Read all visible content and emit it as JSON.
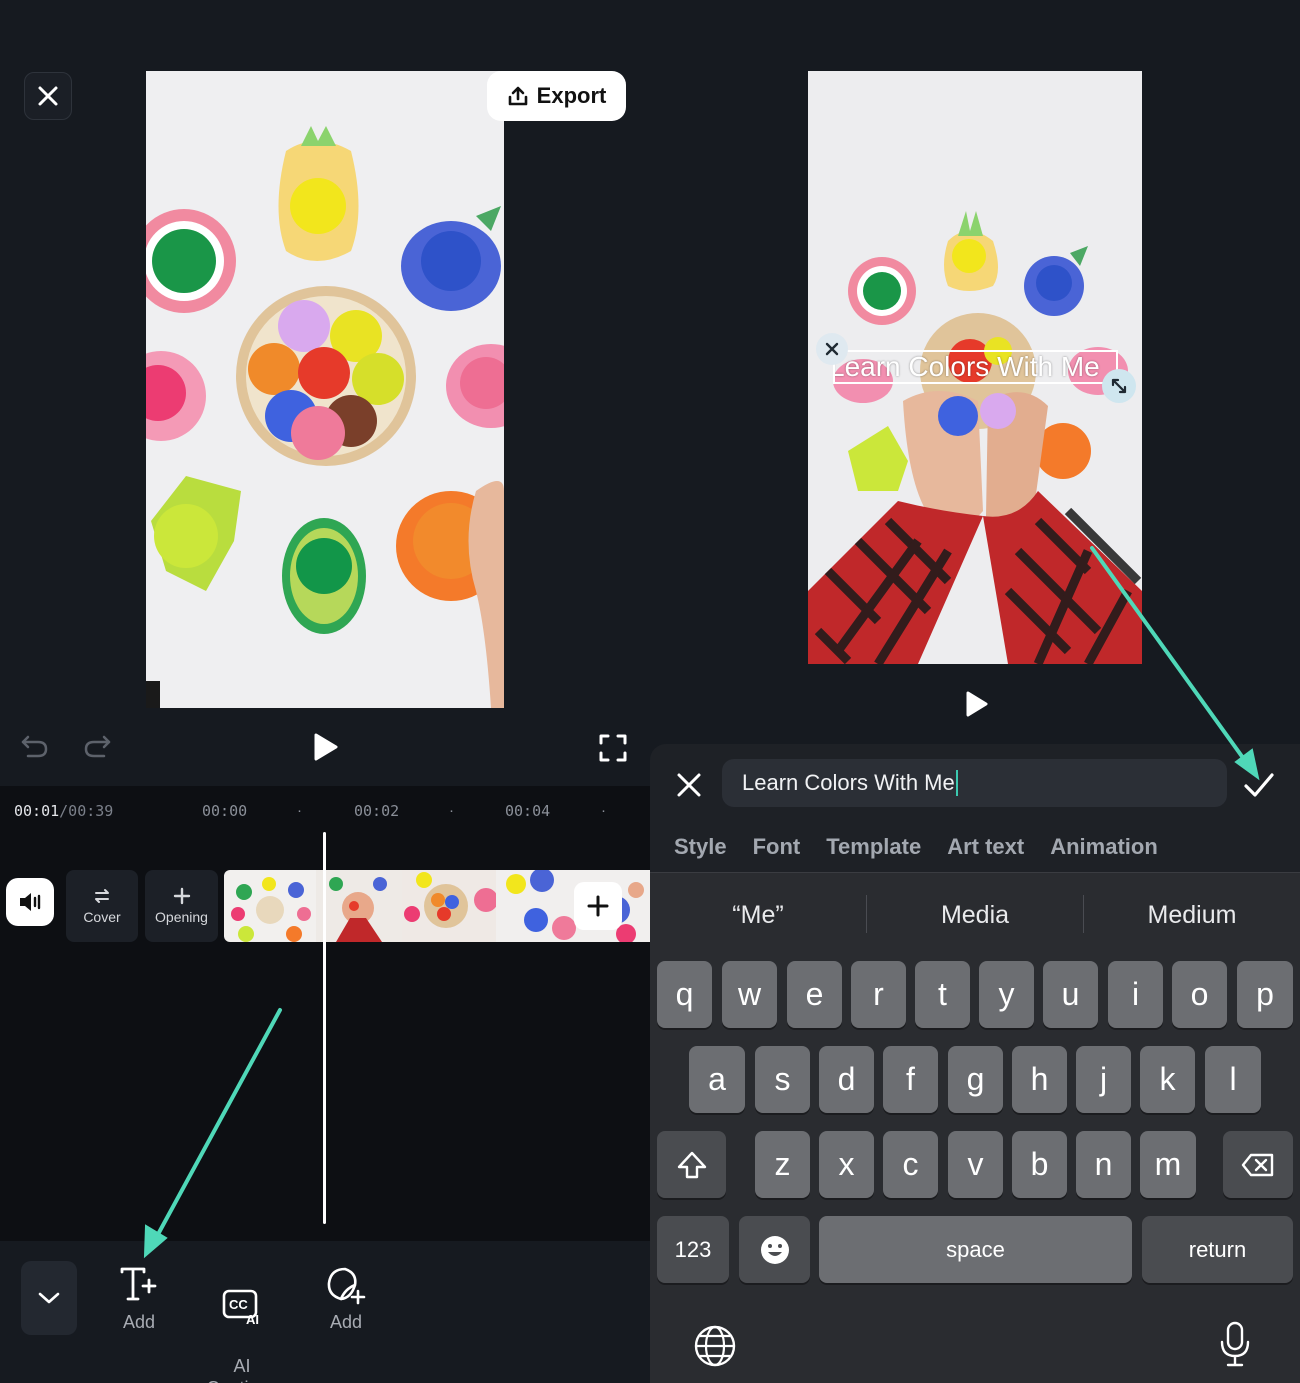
{
  "left": {
    "export_label": "Export",
    "timecode_current": "00:01",
    "timecode_total": "/00:39",
    "ruler_ticks": [
      "00:00",
      "00:02",
      "00:04"
    ],
    "cover_label": "Cover",
    "opening_label": "Opening",
    "toolbar": {
      "add_text_label": "Add",
      "ai_captions_label": "AI\nCaptions",
      "add_sticker_label": "Add"
    }
  },
  "right": {
    "overlay_text": "Learn Colors With Me",
    "input_value": "Learn Colors With Me",
    "tabs": [
      "Style",
      "Font",
      "Template",
      "Art text",
      "Animation"
    ],
    "suggestions": [
      "“Me”",
      "Media",
      "Medium"
    ],
    "keys_row1": [
      "q",
      "w",
      "e",
      "r",
      "t",
      "y",
      "u",
      "i",
      "o",
      "p"
    ],
    "keys_row2": [
      "a",
      "s",
      "d",
      "f",
      "g",
      "h",
      "j",
      "k",
      "l"
    ],
    "keys_row3": [
      "z",
      "x",
      "c",
      "v",
      "b",
      "n",
      "m"
    ],
    "key_123": "123",
    "key_space": "space",
    "key_return": "return"
  },
  "colors": {
    "accent_arrow": "#4fd8b8",
    "background": "#161a20",
    "keyboard_bg": "#2a2c30"
  }
}
